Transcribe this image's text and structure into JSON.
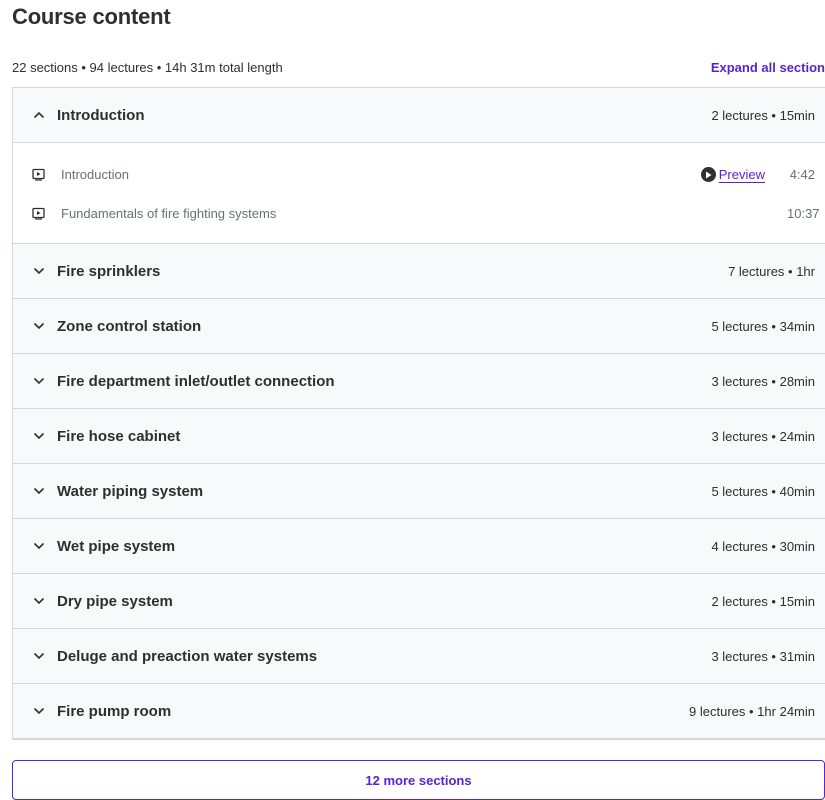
{
  "header": {
    "title": "Course content",
    "summary": "22 sections • 94 lectures • 14h 31m total length",
    "expand_label": "Expand all section"
  },
  "sections": [
    {
      "title": "Introduction",
      "meta": "2 lectures • 15min",
      "expanded": true,
      "icon": "chevron-up-icon",
      "lectures": [
        {
          "title": "Introduction",
          "preview": "Preview",
          "duration": "4:42",
          "icon": "video-icon"
        },
        {
          "title": "Fundamentals of fire fighting systems",
          "duration": "10:37",
          "icon": "video-icon"
        }
      ]
    },
    {
      "title": "Fire sprinklers",
      "meta": "7 lectures • 1hr",
      "expanded": false,
      "icon": "chevron-down-icon"
    },
    {
      "title": "Zone control station",
      "meta": "5 lectures • 34min",
      "expanded": false,
      "icon": "chevron-down-icon"
    },
    {
      "title": "Fire department inlet/outlet connection",
      "meta": "3 lectures • 28min",
      "expanded": false,
      "icon": "chevron-down-icon"
    },
    {
      "title": "Fire hose cabinet",
      "meta": "3 lectures • 24min",
      "expanded": false,
      "icon": "chevron-down-icon"
    },
    {
      "title": "Water piping system",
      "meta": "5 lectures • 40min",
      "expanded": false,
      "icon": "chevron-down-icon"
    },
    {
      "title": "Wet pipe system",
      "meta": "4 lectures • 30min",
      "expanded": false,
      "icon": "chevron-down-icon"
    },
    {
      "title": "Dry pipe system",
      "meta": "2 lectures • 15min",
      "expanded": false,
      "icon": "chevron-down-icon"
    },
    {
      "title": "Deluge and preaction water systems",
      "meta": "3 lectures • 31min",
      "expanded": false,
      "icon": "chevron-down-icon"
    },
    {
      "title": "Fire pump room",
      "meta": "9 lectures • 1hr 24min",
      "expanded": false,
      "icon": "chevron-down-icon"
    }
  ],
  "more_button": "12 more sections",
  "colors": {
    "accent": "#5624d0",
    "header_bg": "#f7f9fa",
    "border": "#d1d7dc",
    "text": "#2d2f31",
    "muted": "#6a6f73"
  }
}
